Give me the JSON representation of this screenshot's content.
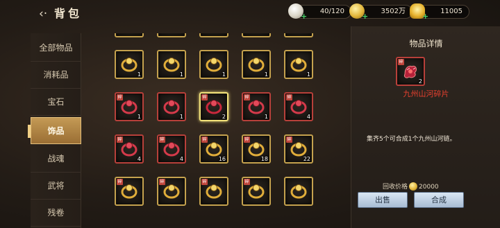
{
  "header": {
    "back_icon": "‹·",
    "title": "背包",
    "resources": [
      {
        "icon": "pearl-icon",
        "value": "40/120"
      },
      {
        "icon": "coin-icon",
        "value": "3502万"
      },
      {
        "icon": "gold-ingot-icon",
        "value": "11005"
      }
    ]
  },
  "sidebar": {
    "items": [
      {
        "label": "全部物品"
      },
      {
        "label": "消耗品"
      },
      {
        "label": "宝石"
      },
      {
        "label": "饰品",
        "active": true
      },
      {
        "label": "战魂"
      },
      {
        "label": "武将"
      },
      {
        "label": "残卷"
      }
    ]
  },
  "grid": {
    "rows": [
      [
        {
          "icon": "amethyst-necklace-icon",
          "count": "1",
          "frame": "gold",
          "tag": ""
        },
        {
          "icon": "dragon-pendant-icon",
          "count": "1",
          "frame": "gold",
          "tag": ""
        },
        {
          "icon": "gold-hairpin-icon",
          "count": "1",
          "frame": "gold",
          "tag": ""
        },
        {
          "icon": "turquoise-necklace-icon",
          "count": "1",
          "frame": "gold",
          "tag": ""
        },
        {
          "icon": "gold-ring-icon",
          "count": "1",
          "frame": "gold",
          "tag": ""
        }
      ],
      [
        {
          "icon": "ruby-ring-icon",
          "count": "1",
          "frame": "red",
          "tag": "碎"
        },
        {
          "icon": "red-dragon-ornament-icon",
          "count": "1",
          "frame": "red",
          "tag": ""
        },
        {
          "icon": "river-fragment-icon",
          "count": "2",
          "frame": "selected",
          "tag": "碎"
        },
        {
          "icon": "crimson-ring-icon",
          "count": "1",
          "frame": "red",
          "tag": "碎"
        },
        {
          "icon": "red-bracelet-icon",
          "count": "4",
          "frame": "red",
          "tag": "碎"
        }
      ],
      [
        {
          "icon": "ruby-band-icon",
          "count": "4",
          "frame": "red",
          "tag": "碎"
        },
        {
          "icon": "engraved-ring-icon",
          "count": "4",
          "frame": "red",
          "tag": "碎"
        },
        {
          "icon": "gold-scroll-icon",
          "count": "16",
          "frame": "gold",
          "tag": "碎"
        },
        {
          "icon": "sapphire-crown-icon",
          "count": "18",
          "frame": "gold",
          "tag": "碎"
        },
        {
          "icon": "sapphire-ring-icon",
          "count": "22",
          "frame": "gold",
          "tag": "碎"
        }
      ],
      [
        {
          "icon": "gold-ring-icon",
          "count": "",
          "frame": "gold",
          "tag": "碎"
        },
        {
          "icon": "gold-crown-icon",
          "count": "",
          "frame": "gold",
          "tag": "碎"
        },
        {
          "icon": "gold-hairpin-icon",
          "count": "",
          "frame": "gold",
          "tag": "碎"
        },
        {
          "icon": "gold-ornament-icon",
          "count": "",
          "frame": "gold",
          "tag": "碎"
        },
        {
          "icon": "dark-ring-icon",
          "count": "",
          "frame": "gold",
          "tag": ""
        }
      ]
    ]
  },
  "detail": {
    "heading": "物品详情",
    "item_icon": "river-fragment-icon",
    "item_count": "2",
    "item_tag": "碎",
    "item_name": "九州山河碎片",
    "description": "集齐5个可合成1个九州山河链。",
    "recycle_label": "回收价格",
    "recycle_price": "20000",
    "sell_label": "出售",
    "combine_label": "合成"
  },
  "colors": {
    "accent_gold": "#c5a24e",
    "item_name_red": "#e8412f",
    "selected_frame": "#f3e27a",
    "active_tab": "#b38548"
  }
}
